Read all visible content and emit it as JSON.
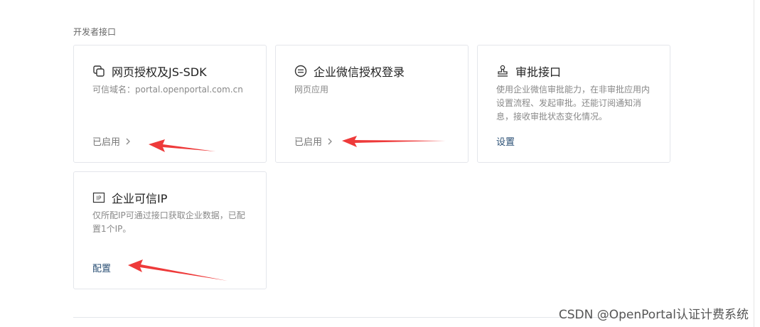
{
  "section": {
    "title": "开发者接口"
  },
  "cards": [
    {
      "icon": "copy-icon",
      "title": "网页授权及JS-SDK",
      "desc": "可信域名：portal.openportal.com.cn",
      "action": "已启用"
    },
    {
      "icon": "minus-circle-icon",
      "title": "企业微信授权登录",
      "desc": "网页应用",
      "action": "已启用"
    },
    {
      "icon": "stamp-icon",
      "title": "审批接口",
      "desc_lines": [
        "使用企业微信审批能力，在非审批应用内",
        "设置流程、发起审批。还能订阅通知消",
        "息，接收审批状态变化情况。"
      ],
      "action": "设置"
    },
    {
      "icon": "ip-icon",
      "title": "企业可信IP",
      "desc_lines": [
        "仅所配IP可通过接口获取企业数据，已配",
        "置1个IP。"
      ],
      "action": "配置"
    }
  ],
  "watermark": "CSDN @OpenPortal认证计费系统",
  "colors": {
    "annotation_arrow": "#ee3a3a",
    "link": "#2a4f74",
    "border": "#e4e6eb"
  }
}
